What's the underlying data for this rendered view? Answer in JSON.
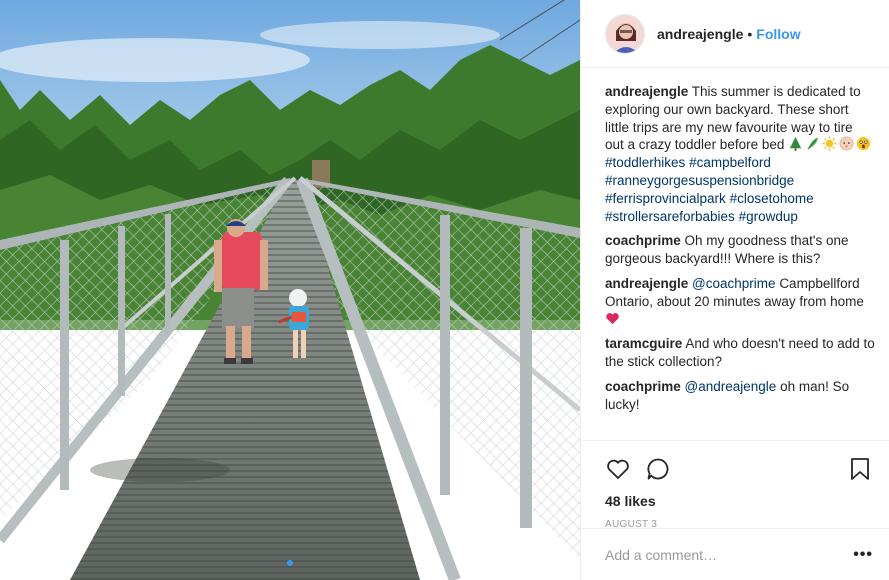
{
  "post": {
    "username": "andreajengle",
    "separator": "•",
    "follow_label": "Follow",
    "caption": {
      "username": "andreajengle",
      "text": "This summer is dedicated to exploring our own backyard. These short little trips are my new favourite way to tire out a crazy toddler before bed",
      "emojis": [
        "evergreen-tree",
        "herb",
        "sun",
        "baby",
        "astonished-face"
      ],
      "hashtags": [
        "#toddlerhikes",
        "#campbelford",
        "#ranneygorgesuspensionbridge",
        "#ferrisprovincialpark",
        "#closetohome",
        "#strollersareforbabies",
        "#growdup"
      ]
    },
    "comments": [
      {
        "username": "coachprime",
        "text": "Oh my goodness that's one gorgeous backyard!!! Where is this?"
      },
      {
        "username": "andreajengle",
        "mention": "@coachprime",
        "text": "Campbellford Ontario, about 20 minutes away from home",
        "emoji": "red-heart"
      },
      {
        "username": "taramcguire",
        "text": "And who doesn't need to add to the stick collection?"
      },
      {
        "username": "coachprime",
        "mention": "@andreajengle",
        "text": "oh man! So lucky!"
      }
    ],
    "likes": "48 likes",
    "date": "AUGUST 3",
    "add_comment_placeholder": "Add a comment…",
    "more_label": "•••",
    "carousel": {
      "count": 1,
      "active": 0
    }
  },
  "icons": {
    "like": "heart-outline-icon",
    "comment": "speech-bubble-icon",
    "save": "bookmark-icon"
  },
  "colors": {
    "link_blue": "#3897f0",
    "hashtag": "#003569",
    "text": "#262626",
    "muted": "#999999",
    "heart": "#ed4956"
  }
}
